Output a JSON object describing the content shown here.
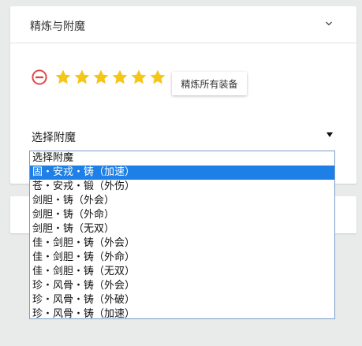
{
  "panel": {
    "title": "精炼与附魔",
    "refine_all_label": "精炼所有装备",
    "stars_filled": 6,
    "stars_total": 6,
    "colors": {
      "star": "#f5c518",
      "minus_icon": "#e04848",
      "selected_option_bg": "#1e80e6"
    }
  },
  "enchant_select": {
    "label": "选择附魔",
    "options": [
      "选择附魔",
      "固・安戎・铸（加速）",
      "苍・安戎・锻（外伤）",
      "剑胆・铸（外会）",
      "剑胆・铸（外命）",
      "剑胆・铸（无双）",
      "佳・剑胆・铸（外会）",
      "佳・剑胆・铸（外命）",
      "佳・剑胆・铸（无双）",
      "珍・风骨・铸（外会）",
      "珍・风骨・铸（外破）",
      "珍・风骨・铸（加速）"
    ],
    "highlighted_index": 1
  }
}
